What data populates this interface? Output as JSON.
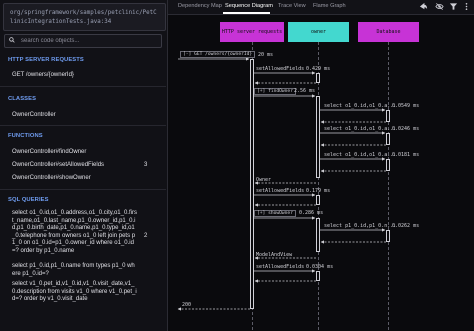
{
  "sidebar": {
    "file_path": "org/springframework/samples/petclinic/PetClinicIntegrationTests.java:34",
    "search_placeholder": "search code objects...",
    "sections": {
      "http": {
        "title": "HTTP SERVER REQUESTS",
        "items": [
          {
            "label": "GET /owners/{ownerId}"
          }
        ]
      },
      "classes": {
        "title": "CLASSES",
        "items": [
          {
            "label": "OwnerController"
          }
        ]
      },
      "functions": {
        "title": "FUNCTIONS",
        "items": [
          {
            "label": "OwnerController#findOwner",
            "count": ""
          },
          {
            "label": "OwnerController#setAllowedFields",
            "count": "3"
          },
          {
            "label": "OwnerController#showOwner",
            "count": ""
          }
        ]
      },
      "sql": {
        "title": "SQL QUERIES",
        "items": [
          {
            "label": "select o1_0.id,o1_0.address,o1_0.city,o1_0.first_name,o1_0.last_name,p1_0.owner_id,p1_0.id,p1_0.birth_date,p1_0.name,p1_0.type_id,o1_0.telephone from owners o1_0 left join pets p1_0 on o1_0.id=p1_0.owner_id where o1_0.id=? order by p1_0.name",
            "count": "2"
          },
          {
            "label": "select p1_0.id,p1_0.name from types p1_0 where p1_0.id=?",
            "count": ""
          },
          {
            "label": "select v1_0.pet_id,v1_0.id,v1_0.visit_date,v1_0.description from visits v1_0 where v1_0.pet_id=? order by v1_0.visit_date",
            "count": ""
          }
        ]
      }
    }
  },
  "tabs": [
    {
      "label": "Dependency Map",
      "active": false
    },
    {
      "label": "Sequence Diagram",
      "active": true
    },
    {
      "label": "Trace View",
      "active": false
    },
    {
      "label": "Flame Graph",
      "active": false
    }
  ],
  "toolbar": {
    "icons": [
      "share-icon",
      "eye-off-icon",
      "filter-icon",
      "more-icon"
    ]
  },
  "diagram": {
    "actors": [
      {
        "label": "HTTP server requests",
        "color": "#c733d6"
      },
      {
        "label": "owner",
        "color": "#43d8cf"
      },
      {
        "label": "Database",
        "color": "#c733d6"
      }
    ],
    "messages": {
      "m1": "[-] GET /owners/{ownerId}",
      "m1_dur": "20 ms",
      "m2": "setAllowedFields",
      "m2_dur": "0.429 ms",
      "m3": "[+] findOwner",
      "m3_dur": "2.56 ms",
      "sql_label": "select o1_0.id,o1_0.a...",
      "sql_durs": [
        "0.0549 ms",
        "0.0246 ms",
        "0.0181 ms"
      ],
      "owner_ret": "Owner",
      "m4": "setAllowedFields",
      "m4_dur": "0.179 ms",
      "m5": "[+] showOwner",
      "m5_dur": "0.286 ms",
      "sql2_label": "select p1_0.id,p1_0.n...",
      "sql2_dur": "0.0262 ms",
      "model_ret": "ModelAndView",
      "m6": "setAllowedFields",
      "m6_dur": "0.0304 ms",
      "final_ret": "200"
    }
  }
}
